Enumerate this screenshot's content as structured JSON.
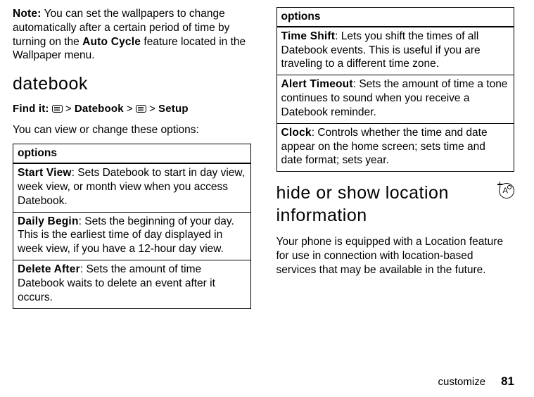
{
  "left": {
    "note_label": "Note:",
    "note_text_pre": " You can set the wallpapers to change automatically after a certain period of time by turning on the ",
    "note_feature": "Auto Cycle",
    "note_text_post": " feature located in the Wallpaper menu.",
    "datebook_heading": "datebook",
    "find_it_label": "Find it:",
    "gt1": " > ",
    "menu1": "Datebook",
    "gt2": " > ",
    "gt3": " > ",
    "menu2": "Setup",
    "lead": "You can view or change these options:",
    "opts_header": "options",
    "rows": [
      {
        "title": "Start View",
        "body": ": Sets Datebook to start in day view, week view, or month view when you access Datebook."
      },
      {
        "title": "Daily Begin",
        "body": ": Sets the beginning of your day. This is the earliest time of day displayed in week view, if you have a 12-hour day view."
      },
      {
        "title": "Delete After",
        "body": ": Sets the amount of time Datebook waits to delete an event after it occurs."
      }
    ]
  },
  "right": {
    "opts_header": "options",
    "rows": [
      {
        "title": "Time Shift",
        "body": ": Lets you shift the times of all Datebook events. This is useful if you are traveling to a different time zone."
      },
      {
        "title": "Alert Timeout",
        "body": ": Sets the amount of time a tone continues to sound when you receive a Datebook reminder."
      },
      {
        "title": "Clock",
        "body": ": Controls whether the time and date appear on the home screen; sets time and date format; sets year."
      }
    ],
    "hide_show_heading": "hide or show location information",
    "location_para": "Your phone is equipped with a Location feature for use in connection with location-based services that may be available in the future."
  },
  "footer": {
    "section": "customize",
    "page": "81"
  }
}
